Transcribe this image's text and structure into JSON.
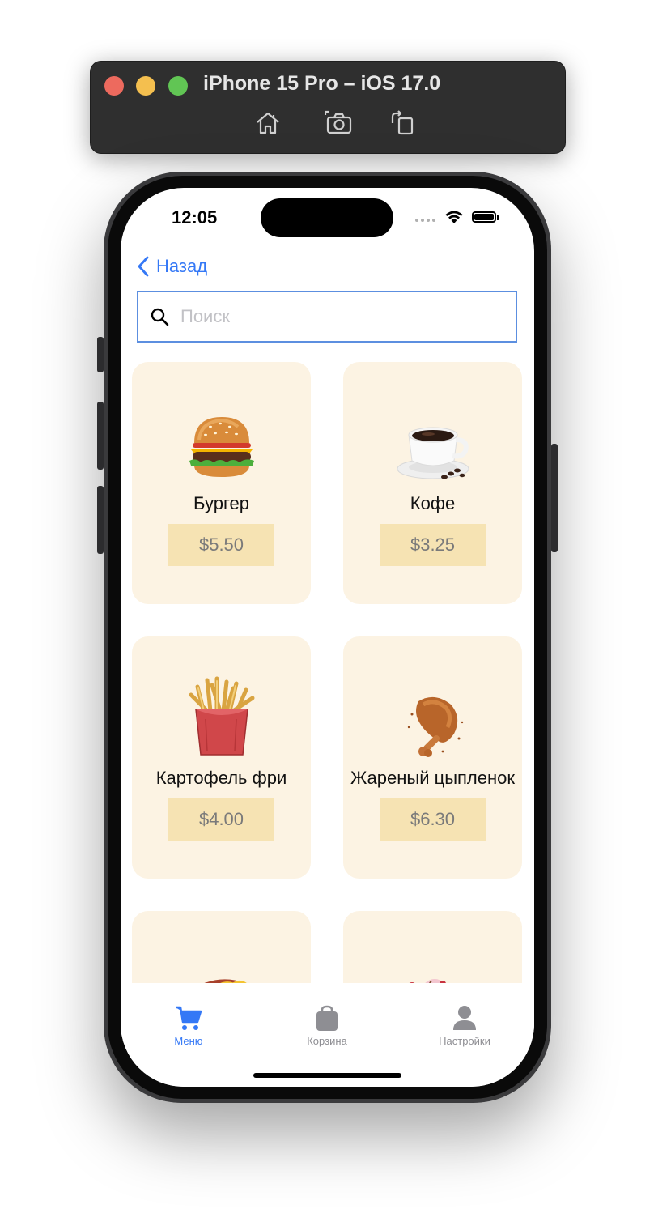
{
  "simulator": {
    "title": "iPhone 15 Pro – iOS 17.0",
    "tools": [
      "home-icon",
      "screenshot-icon",
      "rotate-icon"
    ]
  },
  "status_bar": {
    "time": "12:05"
  },
  "nav": {
    "back_label": "Назад"
  },
  "search": {
    "placeholder": "Поиск",
    "value": ""
  },
  "menu_items": [
    {
      "name": "Бургер",
      "price": "$5.50",
      "icon": "burger-image"
    },
    {
      "name": "Кофе",
      "price": "$3.25",
      "icon": "coffee-image"
    },
    {
      "name": "Картофель фри",
      "price": "$4.00",
      "icon": "fries-image"
    },
    {
      "name": "Жареный цыпленок",
      "price": "$6.30",
      "icon": "fried-chicken-image"
    },
    {
      "name": "",
      "price": "",
      "icon": "hotdog-image"
    },
    {
      "name": "",
      "price": "",
      "icon": "ice-cream-image"
    }
  ],
  "tabbar": {
    "items": [
      {
        "label": "Меню",
        "icon": "cart-icon",
        "active": true
      },
      {
        "label": "Корзина",
        "icon": "bag-icon",
        "active": false
      },
      {
        "label": "Настройки",
        "icon": "person-icon",
        "active": false
      }
    ]
  },
  "colors": {
    "accent": "#3478f6",
    "card_bg": "#fcf3e3",
    "price_bg": "#f6e3b3"
  }
}
